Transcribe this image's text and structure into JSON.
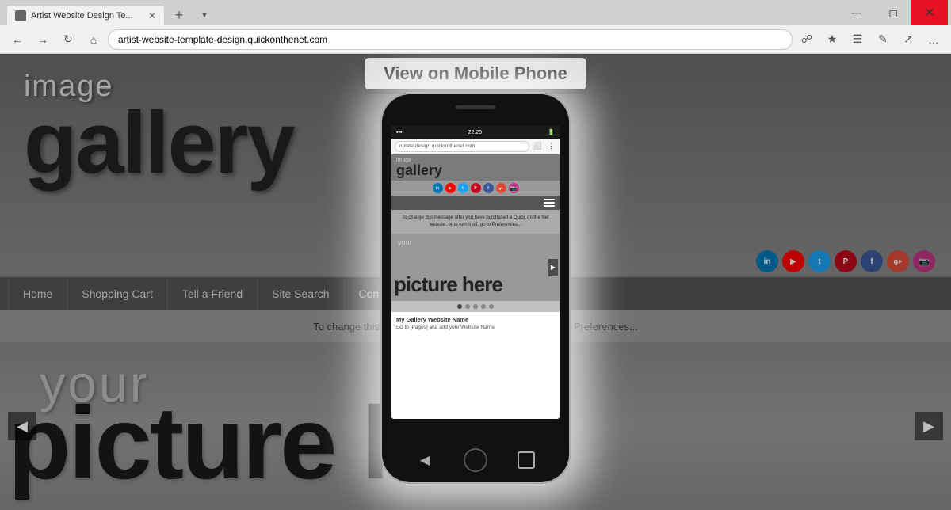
{
  "browser": {
    "tab_title": "Artist Website Design Te...",
    "url": "artist-website-template-design.quickonthenet.com",
    "url_domain": "quickonthenet.com"
  },
  "website": {
    "image_text": "image",
    "gallery_text": "gallery",
    "your_text": "your",
    "picture_here_text": "picture here",
    "nav_items": [
      "Home",
      "Shopping Cart",
      "Tell a Friend",
      "Site Search",
      "Contact For"
    ],
    "message_text": "To change this message after you have purchased a Quick on the Net website, or to turn it off, go to Preferences...",
    "message_short": "To change this message after you h",
    "message_end": "to turn it off, go to Preferences..."
  },
  "modal": {
    "label": "View on Mobile Phone"
  },
  "phone": {
    "time": "22:25",
    "address": "nplate-design.quickonthenet.com",
    "gallery_small": "image",
    "gallery_big": "gallery",
    "message": "To change this message after you have purchased a Quick on the Net website, or to turn it off, go to Preferences...",
    "site_name": "My Gallery Website Name",
    "site_note": "Go to [Pages] and add your Website Name",
    "nav_dots": [
      1,
      2,
      3,
      4,
      5
    ]
  },
  "social_icons": [
    {
      "name": "linkedin",
      "color": "#0077b5",
      "label": "in"
    },
    {
      "name": "youtube",
      "color": "#ff0000",
      "label": "▶"
    },
    {
      "name": "twitter",
      "color": "#1da1f2",
      "label": "t"
    },
    {
      "name": "pinterest",
      "color": "#bd081c",
      "label": "p"
    },
    {
      "name": "facebook",
      "color": "#3b5998",
      "label": "f"
    },
    {
      "name": "google-plus",
      "color": "#dd4b39",
      "label": "g+"
    },
    {
      "name": "instagram",
      "color": "#c13584",
      "label": "📷"
    }
  ],
  "colors": {
    "nav_bg": "#555555",
    "gallery_bg": "#7a7a7a",
    "accent": "#444444"
  }
}
